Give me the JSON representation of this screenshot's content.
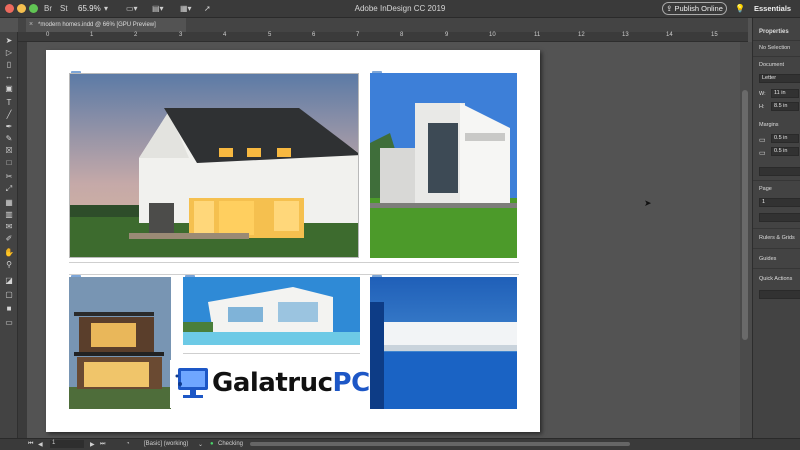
{
  "app": {
    "title": "Adobe InDesign CC 2019",
    "zoom": "65.9%",
    "publish_label": "Publish Online",
    "workspace": "Essentials"
  },
  "doc_tab": {
    "label": "*modern homes.indd @ 66% [GPU Preview]"
  },
  "ruler": {
    "ticks": [
      "0",
      "1",
      "2",
      "3",
      "4",
      "5",
      "6",
      "7",
      "8",
      "9",
      "10",
      "11",
      "12",
      "13",
      "14",
      "15"
    ]
  },
  "properties": {
    "title": "Properties",
    "selection": "No Selection",
    "document_heading": "Document",
    "preset": "Letter",
    "w_label": "W:",
    "w_value": "11 in",
    "h_label": "H:",
    "h_value": "8.5 in",
    "margins_heading": "Margins",
    "margin1": "0.5 in",
    "margin2": "0.5 in",
    "page_heading": "Page",
    "page_value": "1",
    "rulers_heading": "Rulers & Grids",
    "guides_heading": "Guides",
    "quick_actions": "Quick Actions"
  },
  "status": {
    "page_number": "1",
    "style": "[Basic] (working)",
    "preflight": "Checking"
  },
  "watermark": {
    "text_main": "Galatruc",
    "text_accent": "PC"
  },
  "images": [
    {
      "name": "house-dusk-photo"
    },
    {
      "name": "white-modern-house-photo"
    },
    {
      "name": "wood-house-lit-photo"
    },
    {
      "name": "white-villa-pool-photo"
    },
    {
      "name": "blue-pool-house-photo"
    }
  ]
}
